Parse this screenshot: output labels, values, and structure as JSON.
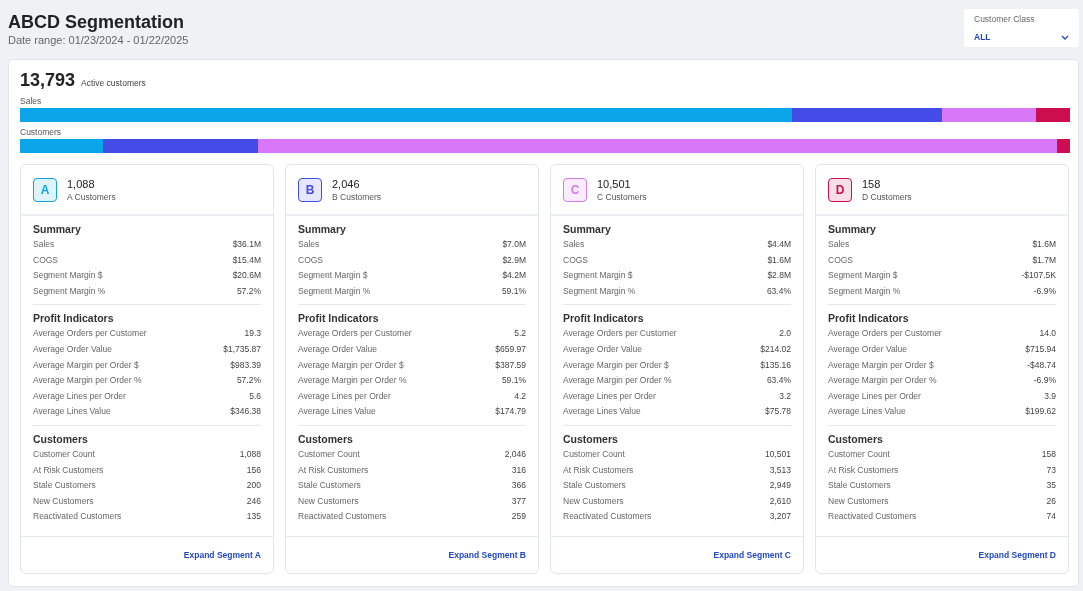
{
  "header": {
    "title": "ABCD Segmentation",
    "subtitle": "Date range: 01/23/2024 - 01/22/2025"
  },
  "filter": {
    "label": "Customer Class",
    "value": "ALL"
  },
  "overview": {
    "count": "13,793",
    "count_label": "Active customers",
    "bars": [
      {
        "label": "Sales",
        "parts": [
          {
            "color": "#0ba5e9"
          },
          {
            "color": "#434ce6"
          },
          {
            "color": "#d877f8"
          },
          {
            "color": "#cc0d4e"
          }
        ]
      },
      {
        "label": "Customers",
        "parts": [
          {
            "color": "#0ba5e9"
          },
          {
            "color": "#434ce6"
          },
          {
            "color": "#d877f8"
          },
          {
            "color": "#cc0d4e"
          }
        ]
      }
    ]
  },
  "segments": [
    {
      "letter": "A",
      "color": "#0ba5e9",
      "count": "1,088",
      "label": "A Customers",
      "sections": [
        {
          "title": "Summary",
          "rows": [
            [
              "Sales",
              "$36.1M"
            ],
            [
              "COGS",
              "$15.4M"
            ],
            [
              "Segment Margin $",
              "$20.6M"
            ],
            [
              "Segment Margin %",
              "57.2%"
            ]
          ]
        },
        {
          "title": "Profit Indicators",
          "rows": [
            [
              "Average Orders per Customer",
              "19.3"
            ],
            [
              "Average Order Value",
              "$1,735.87"
            ],
            [
              "Average Margin per Order $",
              "$983.39"
            ],
            [
              "Average Margin per Order %",
              "57.2%"
            ],
            [
              "Average Lines per Order",
              "5.6"
            ],
            [
              "Average Lines Value",
              "$346.38"
            ]
          ]
        },
        {
          "title": "Customers",
          "rows": [
            [
              "Customer Count",
              "1,088"
            ],
            [
              "At Risk Customers",
              "156"
            ],
            [
              "Stale Customers",
              "200"
            ],
            [
              "New Customers",
              "246"
            ],
            [
              "Reactivated Customers",
              "135"
            ]
          ]
        }
      ],
      "link": "Expand Segment A"
    },
    {
      "letter": "B",
      "color": "#434ce6",
      "count": "2,046",
      "label": "B Customers",
      "sections": [
        {
          "title": "Summary",
          "rows": [
            [
              "Sales",
              "$7.0M"
            ],
            [
              "COGS",
              "$2.9M"
            ],
            [
              "Segment Margin $",
              "$4.2M"
            ],
            [
              "Segment Margin %",
              "59.1%"
            ]
          ]
        },
        {
          "title": "Profit Indicators",
          "rows": [
            [
              "Average Orders per Customer",
              "5.2"
            ],
            [
              "Average Order Value",
              "$659.97"
            ],
            [
              "Average Margin per Order $",
              "$387.59"
            ],
            [
              "Average Margin per Order %",
              "59.1%"
            ],
            [
              "Average Lines per Order",
              "4.2"
            ],
            [
              "Average Lines Value",
              "$174.79"
            ]
          ]
        },
        {
          "title": "Customers",
          "rows": [
            [
              "Customer Count",
              "2,046"
            ],
            [
              "At Risk Customers",
              "316"
            ],
            [
              "Stale Customers",
              "366"
            ],
            [
              "New Customers",
              "377"
            ],
            [
              "Reactivated Customers",
              "259"
            ]
          ]
        }
      ],
      "link": "Expand Segment B"
    },
    {
      "letter": "C",
      "color": "#d877f8",
      "count": "10,501",
      "label": "C Customers",
      "sections": [
        {
          "title": "Summary",
          "rows": [
            [
              "Sales",
              "$4.4M"
            ],
            [
              "COGS",
              "$1.6M"
            ],
            [
              "Segment Margin $",
              "$2.8M"
            ],
            [
              "Segment Margin %",
              "63.4%"
            ]
          ]
        },
        {
          "title": "Profit Indicators",
          "rows": [
            [
              "Average Orders per Customer",
              "2.0"
            ],
            [
              "Average Order Value",
              "$214.02"
            ],
            [
              "Average Margin per Order $",
              "$135.16"
            ],
            [
              "Average Margin per Order %",
              "63.4%"
            ],
            [
              "Average Lines per Order",
              "3.2"
            ],
            [
              "Average Lines Value",
              "$75.78"
            ]
          ]
        },
        {
          "title": "Customers",
          "rows": [
            [
              "Customer Count",
              "10,501"
            ],
            [
              "At Risk Customers",
              "3,513"
            ],
            [
              "Stale Customers",
              "2,949"
            ],
            [
              "New Customers",
              "2,610"
            ],
            [
              "Reactivated Customers",
              "3,207"
            ]
          ]
        }
      ],
      "link": "Expand Segment C"
    },
    {
      "letter": "D",
      "color": "#cc0d4e",
      "count": "158",
      "label": "D Customers",
      "sections": [
        {
          "title": "Summary",
          "rows": [
            [
              "Sales",
              "$1.6M"
            ],
            [
              "COGS",
              "$1.7M"
            ],
            [
              "Segment Margin $",
              "-$107.5K"
            ],
            [
              "Segment Margin %",
              "-6.9%"
            ]
          ]
        },
        {
          "title": "Profit Indicators",
          "rows": [
            [
              "Average Orders per Customer",
              "14.0"
            ],
            [
              "Average Order Value",
              "$715.94"
            ],
            [
              "Average Margin per Order $",
              "-$48.74"
            ],
            [
              "Average Margin per Order %",
              "-6.9%"
            ],
            [
              "Average Lines per Order",
              "3.9"
            ],
            [
              "Average Lines Value",
              "$199.62"
            ]
          ]
        },
        {
          "title": "Customers",
          "rows": [
            [
              "Customer Count",
              "158"
            ],
            [
              "At Risk Customers",
              "73"
            ],
            [
              "Stale Customers",
              "35"
            ],
            [
              "New Customers",
              "26"
            ],
            [
              "Reactivated Customers",
              "74"
            ]
          ]
        }
      ],
      "link": "Expand Segment D"
    }
  ]
}
